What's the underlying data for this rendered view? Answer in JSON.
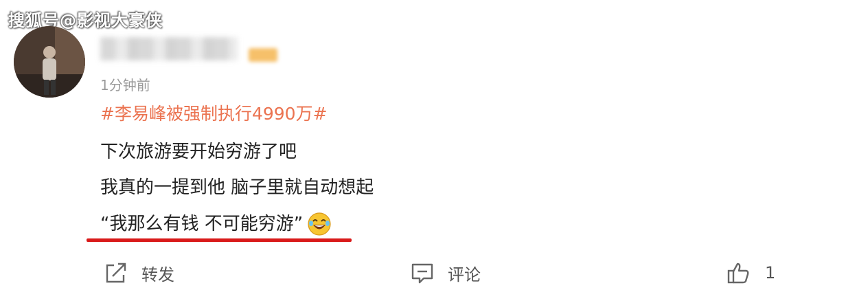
{
  "watermark": "搜狐号@影视大豪侠",
  "post": {
    "timestamp": "1分钟前",
    "hashtag": "#李易峰被强制执行4990万#",
    "lines": [
      "下次旅游要开始穷游了吧",
      "我真的一提到他 脑子里就自动想起"
    ],
    "quote": "“我那么有钱 不可能穷游”",
    "emoji": "laughing-tears-emoji"
  },
  "actions": {
    "share_label": "转发",
    "comment_label": "评论",
    "like_count": "1"
  },
  "colors": {
    "hashtag": "#eb7350",
    "underline": "#d91a1a",
    "text": "#222222",
    "muted": "#9a9a9a"
  }
}
